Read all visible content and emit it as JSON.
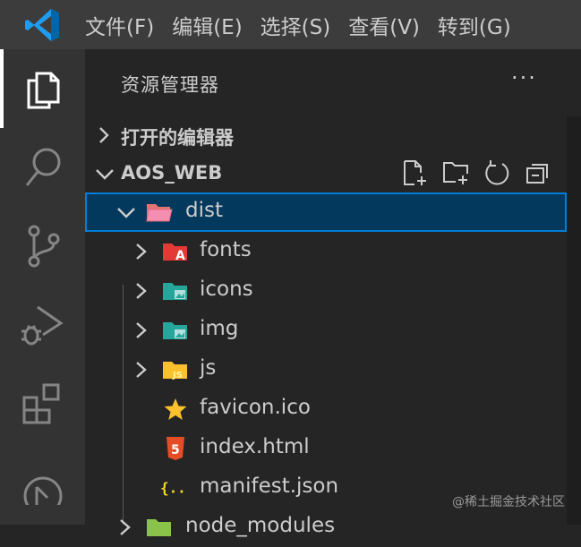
{
  "menu": [
    "文件(F)",
    "编辑(E)",
    "选择(S)",
    "查看(V)",
    "转到(G)"
  ],
  "activity_bar": [
    {
      "icon": "files-icon",
      "active": true
    },
    {
      "icon": "search-icon"
    },
    {
      "icon": "source-control-icon"
    },
    {
      "icon": "run-debug-icon"
    },
    {
      "icon": "extensions-icon"
    },
    {
      "icon": "git-graph-icon"
    }
  ],
  "sidebar": {
    "title": "资源管理器",
    "more_label": "···",
    "open_editors": "打开的编辑器",
    "project": "AOS_WEB"
  },
  "tree": [
    {
      "name": "dist",
      "type": "folder-open",
      "expanded": true,
      "selected": true,
      "icon": "dist-folder-icon",
      "color": "#e06c75"
    },
    {
      "name": "fonts",
      "type": "folder",
      "icon": "fonts-folder-icon",
      "color": "#e53935"
    },
    {
      "name": "icons",
      "type": "folder",
      "icon": "icons-folder-icon",
      "color": "#26a69a"
    },
    {
      "name": "img",
      "type": "folder",
      "icon": "img-folder-icon",
      "color": "#26a69a"
    },
    {
      "name": "js",
      "type": "folder",
      "icon": "js-folder-icon",
      "color": "#fbc02d"
    },
    {
      "name": "favicon.ico",
      "type": "file",
      "icon": "star-icon",
      "color": "#fbc02d"
    },
    {
      "name": "index.html",
      "type": "file",
      "icon": "html5-icon",
      "color": "#e44d26"
    },
    {
      "name": "manifest.json",
      "type": "file",
      "icon": "json-icon",
      "color": "#f5de19"
    },
    {
      "name": "node_modules",
      "type": "folder",
      "icon": "node-folder-icon",
      "color": "#8bc34a"
    }
  ],
  "watermark": "@稀土掘金技术社区"
}
